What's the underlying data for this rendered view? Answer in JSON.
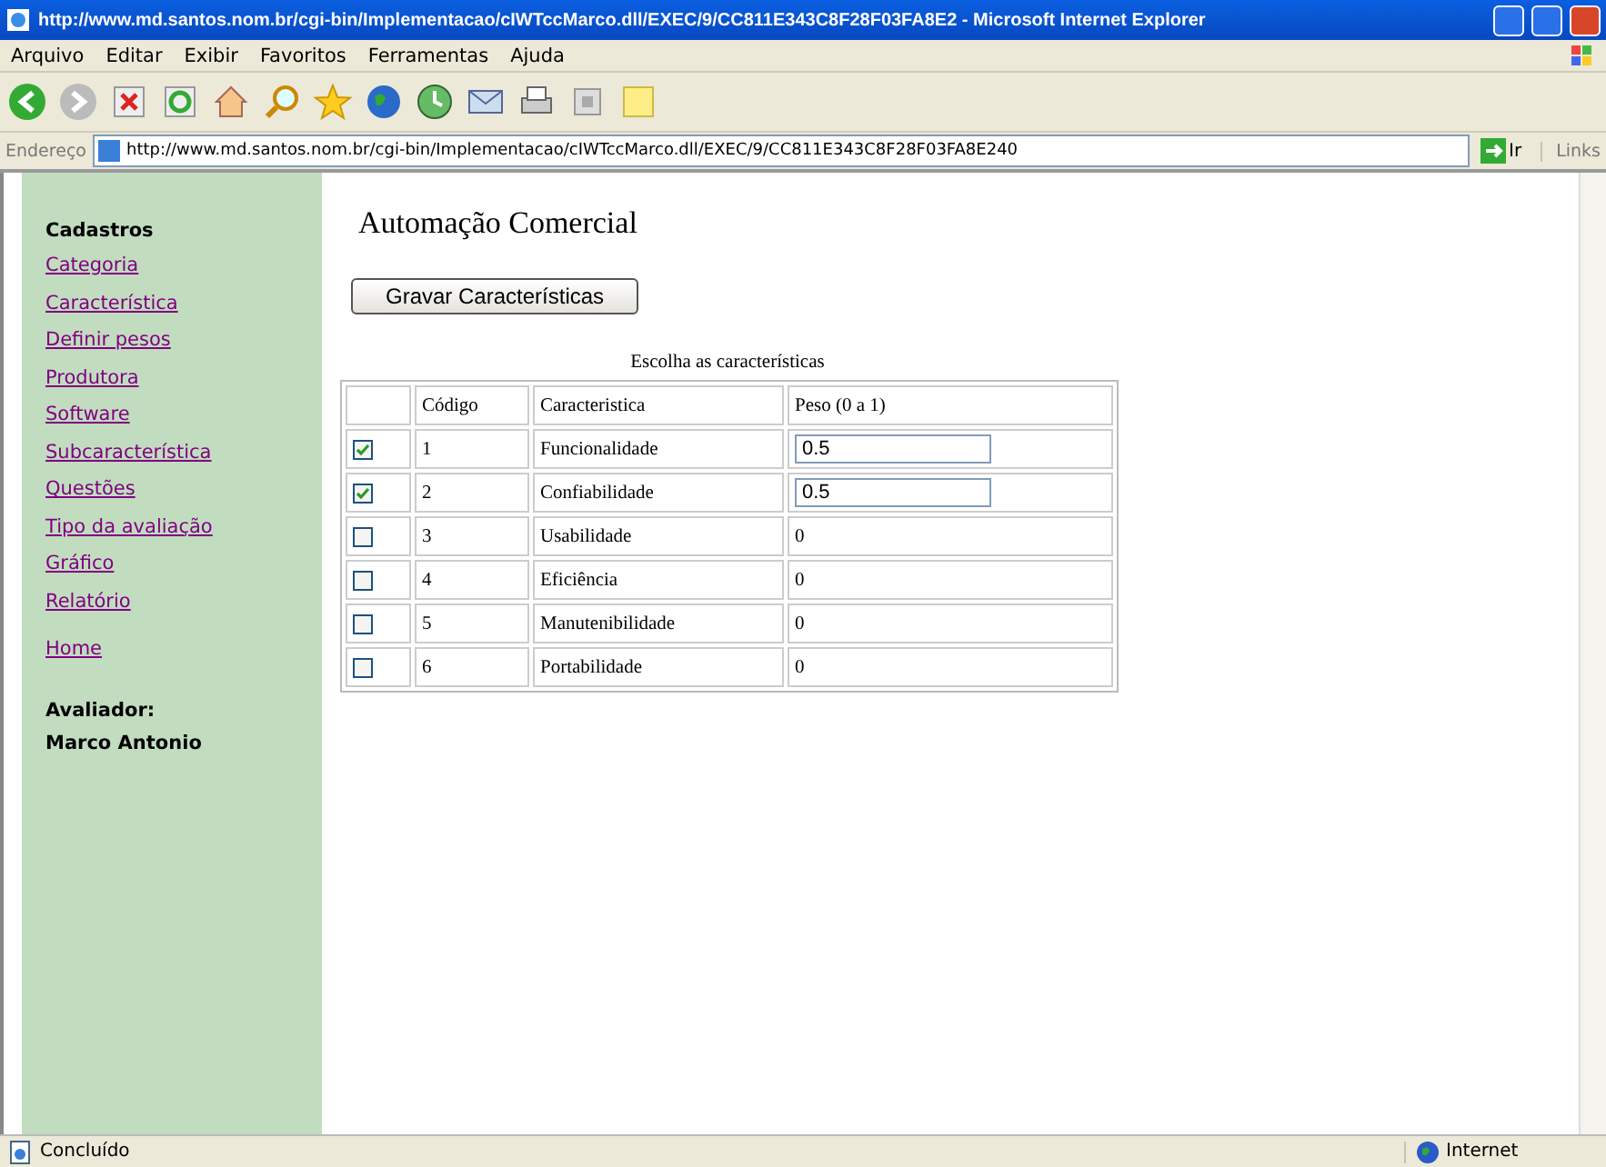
{
  "window": {
    "title": "http://www.md.santos.nom.br/cgi-bin/Implementacao/cIWTccMarco.dll/EXEC/9/CC811E343C8F28F03FA8E2 - Microsoft Internet Explorer"
  },
  "menu": [
    "Arquivo",
    "Editar",
    "Exibir",
    "Favoritos",
    "Ferramentas",
    "Ajuda"
  ],
  "address_bar": {
    "label": "Endereço",
    "value": "http://www.md.santos.nom.br/cgi-bin/Implementacao/cIWTccMarco.dll/EXEC/9/CC811E343C8F28F03FA8E240",
    "go": "Ir",
    "links": "Links"
  },
  "sidebar": {
    "heading": "Cadastros",
    "links": [
      "Categoria",
      "Característica",
      "Definir pesos",
      "Produtora",
      "Software",
      "Subcaracterística",
      "Questões",
      "Tipo da avaliação",
      "Gráfico",
      "Relatório"
    ],
    "home": "Home",
    "evaluator_label": "Avaliador:",
    "evaluator": "Marco Antonio"
  },
  "page": {
    "title": "Automação Comercial",
    "save_button": "Gravar Características",
    "caption": "Escolha as características"
  },
  "table": {
    "columns": [
      "Código",
      "Caracteristica",
      "Peso (0 a 1)"
    ],
    "rows": [
      {
        "checked": true,
        "code": "1",
        "name": "Funcionalidade",
        "weight": "0.5"
      },
      {
        "checked": true,
        "code": "2",
        "name": "Confiabilidade",
        "weight": "0.5"
      },
      {
        "checked": false,
        "code": "3",
        "name": "Usabilidade",
        "weight": "0"
      },
      {
        "checked": false,
        "code": "4",
        "name": "Eficiência",
        "weight": "0"
      },
      {
        "checked": false,
        "code": "5",
        "name": "Manutenibilidade",
        "weight": "0"
      },
      {
        "checked": false,
        "code": "6",
        "name": "Portabilidade",
        "weight": "0"
      }
    ]
  },
  "status_bar": {
    "status": "Concluído",
    "zone": "Internet"
  }
}
